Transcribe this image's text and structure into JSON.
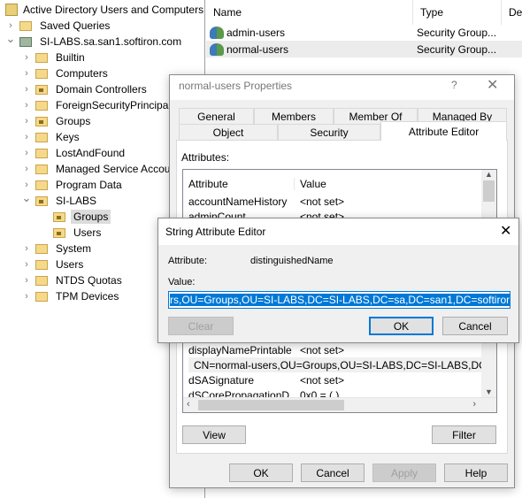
{
  "tree": {
    "root": "Active Directory Users and Computers",
    "items": [
      {
        "label": "Saved Queries",
        "level": 1,
        "expander": "collapsed",
        "icon": "folder"
      },
      {
        "label": "SI-LABS.sa.san1.softiron.com",
        "level": 1,
        "expander": "expanded",
        "icon": "domain"
      },
      {
        "label": "Builtin",
        "level": 2,
        "expander": "collapsed",
        "icon": "folder"
      },
      {
        "label": "Computers",
        "level": 2,
        "expander": "collapsed",
        "icon": "folder"
      },
      {
        "label": "Domain Controllers",
        "level": 2,
        "expander": "collapsed",
        "icon": "ou"
      },
      {
        "label": "ForeignSecurityPrincipals",
        "level": 2,
        "expander": "collapsed",
        "icon": "folder"
      },
      {
        "label": "Groups",
        "level": 2,
        "expander": "collapsed",
        "icon": "ou"
      },
      {
        "label": "Keys",
        "level": 2,
        "expander": "collapsed",
        "icon": "folder"
      },
      {
        "label": "LostAndFound",
        "level": 2,
        "expander": "collapsed",
        "icon": "folder"
      },
      {
        "label": "Managed Service Accounts",
        "level": 2,
        "expander": "collapsed",
        "icon": "folder"
      },
      {
        "label": "Program Data",
        "level": 2,
        "expander": "collapsed",
        "icon": "folder"
      },
      {
        "label": "SI-LABS",
        "level": 2,
        "expander": "expanded",
        "icon": "ou"
      },
      {
        "label": "Groups",
        "level": 3,
        "expander": "none",
        "icon": "ou",
        "selected": true
      },
      {
        "label": "Users",
        "level": 3,
        "expander": "none",
        "icon": "ou"
      },
      {
        "label": "System",
        "level": 2,
        "expander": "collapsed",
        "icon": "folder"
      },
      {
        "label": "Users",
        "level": 2,
        "expander": "collapsed",
        "icon": "folder"
      },
      {
        "label": "NTDS Quotas",
        "level": 2,
        "expander": "collapsed",
        "icon": "folder"
      },
      {
        "label": "TPM Devices",
        "level": 2,
        "expander": "collapsed",
        "icon": "folder"
      }
    ]
  },
  "list": {
    "columns": [
      "Name",
      "Type",
      "Des"
    ],
    "rows": [
      {
        "name": "admin-users",
        "type": "Security Group..."
      },
      {
        "name": "normal-users",
        "type": "Security Group...",
        "selected": true
      }
    ]
  },
  "props": {
    "title": "normal-users Properties",
    "help": "?",
    "tabs_row1": [
      "General",
      "Members",
      "Member Of",
      "Managed By"
    ],
    "tabs_row2": [
      "Object",
      "Security",
      "Attribute Editor"
    ],
    "active_tab": "Attribute Editor",
    "attributes_label": "Attributes:",
    "columns": [
      "Attribute",
      "Value"
    ],
    "rows_top": [
      {
        "a": "accountNameHistory",
        "v": "<not set>"
      },
      {
        "a": "adminCount",
        "v": "<not set>"
      }
    ],
    "rows_bottom": [
      {
        "a": "displayNamePrintable",
        "v": "<not set>"
      },
      {
        "a": "distinguishedName",
        "v": "CN=normal-users,OU=Groups,OU=SI-LABS,DC=SI-LABS,DC=sa,DC=san1,DC=softiron,DC=com",
        "selected": true
      },
      {
        "a": "dSASignature",
        "v": "<not set>"
      },
      {
        "a": "dSCorePropagationD...",
        "v": "0x0 = ( )"
      }
    ],
    "view": "View",
    "filter": "Filter",
    "ok": "OK",
    "cancel": "Cancel",
    "apply": "Apply",
    "help_btn": "Help"
  },
  "editor": {
    "title": "String Attribute Editor",
    "attribute_label": "Attribute:",
    "attribute_value": "distinguishedName",
    "value_label": "Value:",
    "value": "rs,OU=Groups,OU=SI-LABS,DC=SI-LABS,DC=sa,DC=san1,DC=softiron,DC=com",
    "clear": "Clear",
    "ok": "OK",
    "cancel": "Cancel"
  },
  "colors": {
    "selection": "#0078d7",
    "accent_border": "#0078d7"
  }
}
